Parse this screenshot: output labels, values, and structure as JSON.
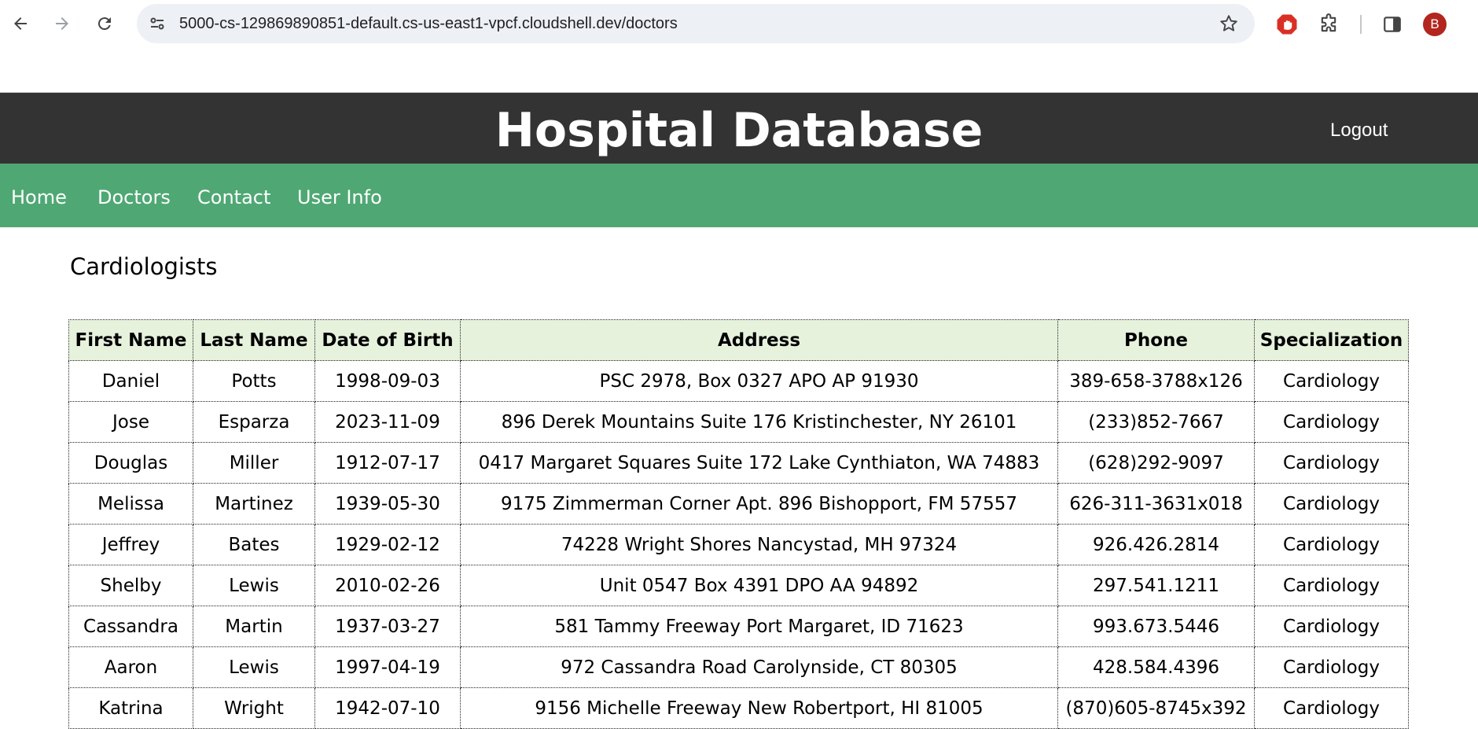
{
  "browser": {
    "url": "5000-cs-129869890851-default.cs-us-east1-vpcf.cloudshell.dev/doctors",
    "profile_initial": "B",
    "icons": [
      "back-arrow-icon",
      "forward-arrow-icon",
      "reload-icon",
      "site-info-icon",
      "bookmark-star-icon",
      "ad-block-extension-icon",
      "extensions-puzzle-icon",
      "side-panel-icon"
    ]
  },
  "header": {
    "title": "Hospital Database",
    "logout_label": "Logout"
  },
  "nav": {
    "items": [
      {
        "label": "Home"
      },
      {
        "label": "Doctors"
      },
      {
        "label": "Contact"
      },
      {
        "label": "User Info"
      }
    ]
  },
  "main": {
    "section_title": "Cardiologists",
    "table": {
      "columns": [
        "First Name",
        "Last Name",
        "Date of Birth",
        "Address",
        "Phone",
        "Specialization"
      ],
      "rows": [
        [
          "Daniel",
          "Potts",
          "1998-09-03",
          "PSC 2978, Box 0327 APO AP 91930",
          "389-658-3788x126",
          "Cardiology"
        ],
        [
          "Jose",
          "Esparza",
          "2023-11-09",
          "896 Derek Mountains Suite 176 Kristinchester, NY 26101",
          "(233)852-7667",
          "Cardiology"
        ],
        [
          "Douglas",
          "Miller",
          "1912-07-17",
          "0417 Margaret Squares Suite 172 Lake Cynthiaton, WA 74883",
          "(628)292-9097",
          "Cardiology"
        ],
        [
          "Melissa",
          "Martinez",
          "1939-05-30",
          "9175 Zimmerman Corner Apt. 896 Bishopport, FM 57557",
          "626-311-3631x018",
          "Cardiology"
        ],
        [
          "Jeffrey",
          "Bates",
          "1929-02-12",
          "74228 Wright Shores Nancystad, MH 97324",
          "926.426.2814",
          "Cardiology"
        ],
        [
          "Shelby",
          "Lewis",
          "2010-02-26",
          "Unit 0547 Box 4391 DPO AA 94892",
          "297.541.1211",
          "Cardiology"
        ],
        [
          "Cassandra",
          "Martin",
          "1937-03-27",
          "581 Tammy Freeway Port Margaret, ID 71623",
          "993.673.5446",
          "Cardiology"
        ],
        [
          "Aaron",
          "Lewis",
          "1997-04-19",
          "972 Cassandra Road Carolynside, CT 80305",
          "428.584.4396",
          "Cardiology"
        ],
        [
          "Katrina",
          "Wright",
          "1942-07-10",
          "9156 Michelle Freeway New Robertport, HI 81005",
          "(870)605-8745x392",
          "Cardiology"
        ]
      ]
    }
  }
}
